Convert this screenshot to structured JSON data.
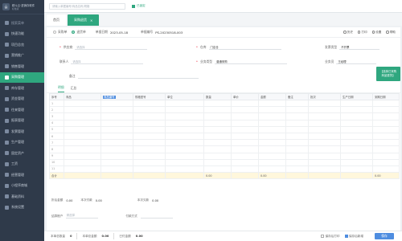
{
  "app": {
    "name": "精斗云·进销存软件",
    "subtitle": "标准版"
  },
  "sidebar": {
    "items": [
      {
        "label": "搜索菜单",
        "icon": "search-icon"
      },
      {
        "label": "快速功能",
        "icon": "star-icon"
      },
      {
        "label": "项目总览",
        "icon": "grid-icon"
      },
      {
        "label": "营销推广",
        "icon": "megaphone-icon"
      },
      {
        "label": "销售管理",
        "icon": "cart-icon"
      },
      {
        "label": "采购管理",
        "icon": "bag-icon",
        "active": true
      },
      {
        "label": "库存管理",
        "icon": "box-icon"
      },
      {
        "label": "资金管理",
        "icon": "money-icon"
      },
      {
        "label": "往来管理",
        "icon": "swap-icon"
      },
      {
        "label": "报表管理",
        "icon": "chart-icon"
      },
      {
        "label": "发票管理",
        "icon": "receipt-icon"
      },
      {
        "label": "生产管理",
        "icon": "factory-icon"
      },
      {
        "label": "固定资产",
        "icon": "building-icon"
      },
      {
        "label": "工资",
        "icon": "wallet-icon"
      },
      {
        "label": "经营管理",
        "icon": "briefcase-icon"
      },
      {
        "label": "小程序商城",
        "icon": "store-icon"
      },
      {
        "label": "基础资料",
        "icon": "database-icon"
      },
      {
        "label": "系统设置",
        "icon": "gear-icon"
      }
    ]
  },
  "topbar": {
    "search_placeholder": "请输入单据编号/商品名称/规格",
    "lock_label": "已锁定"
  },
  "tabs": [
    {
      "label": "首页",
      "active": false
    },
    {
      "label": "采购退货",
      "active": true
    }
  ],
  "toolbar": {
    "radio_purchase": "采购单",
    "radio_return": "退货单",
    "date_label": "单据日期",
    "date_value": "2023-05-18",
    "number_label": "单据编号",
    "number_value": "PS-20230518-003",
    "tools": [
      "历史",
      "打印",
      "设置",
      "帮助"
    ]
  },
  "form": {
    "supplier_label": "供应商",
    "supplier_placeholder": "请选择",
    "warehouse_label": "仓库",
    "warehouse_value": "门店仓",
    "invoice_label": "发票类型",
    "invoice_value": "不开票",
    "contact_label": "联系人",
    "contact_placeholder": "请选择",
    "salesman_label": "业务员",
    "salesman_value": "王经理",
    "remark_label": "备注",
    "remark_placeholder": "",
    "biztype_label": "业务类型",
    "biztype_value": "普通采购",
    "project_label": "项目",
    "green_button_line1": "【选择已采购",
    "green_button_line2": "商品退货】"
  },
  "subtabs": [
    "明细",
    "汇总"
  ],
  "table": {
    "columns": [
      "序号",
      "商品",
      "商品编号",
      "规格型号",
      "单位",
      "数量",
      "单价",
      "金额",
      "备注",
      "批次",
      "生产日期",
      "到期日期"
    ],
    "row_numbers": [
      "1",
      "2",
      "3",
      "4",
      "5",
      "6",
      "7",
      "8",
      "9",
      "10",
      "11"
    ],
    "summary_label": "合计",
    "summary_qty": "0.00",
    "summary_amount": "0.00",
    "summary_total": "0.00"
  },
  "footer": {
    "discount_label": "折后金额",
    "discount_value": "0.00",
    "pay_label": "本次付款",
    "pay_value": "0.00",
    "arrears_label": "本次欠款",
    "arrears_value": "0.00",
    "account_label": "结算账户",
    "account_placeholder": "请选择",
    "method_label": "付款方式"
  },
  "bottombar": {
    "total_qty_label": "本单总数量",
    "total_qty_value": "0",
    "total_amount_label": "本单总金额",
    "total_amount_value": "0.00",
    "paid_label": "已付金额",
    "paid_value": "0.00",
    "print_label": "保存后打印",
    "new_label": "保存后新增",
    "save_label": "保存"
  },
  "colors": {
    "sidebar_bg": "#2f3a4a",
    "accent_green": "#2fa77f",
    "accent_blue": "#4e8de0",
    "summary_row": "#fff7dc"
  }
}
